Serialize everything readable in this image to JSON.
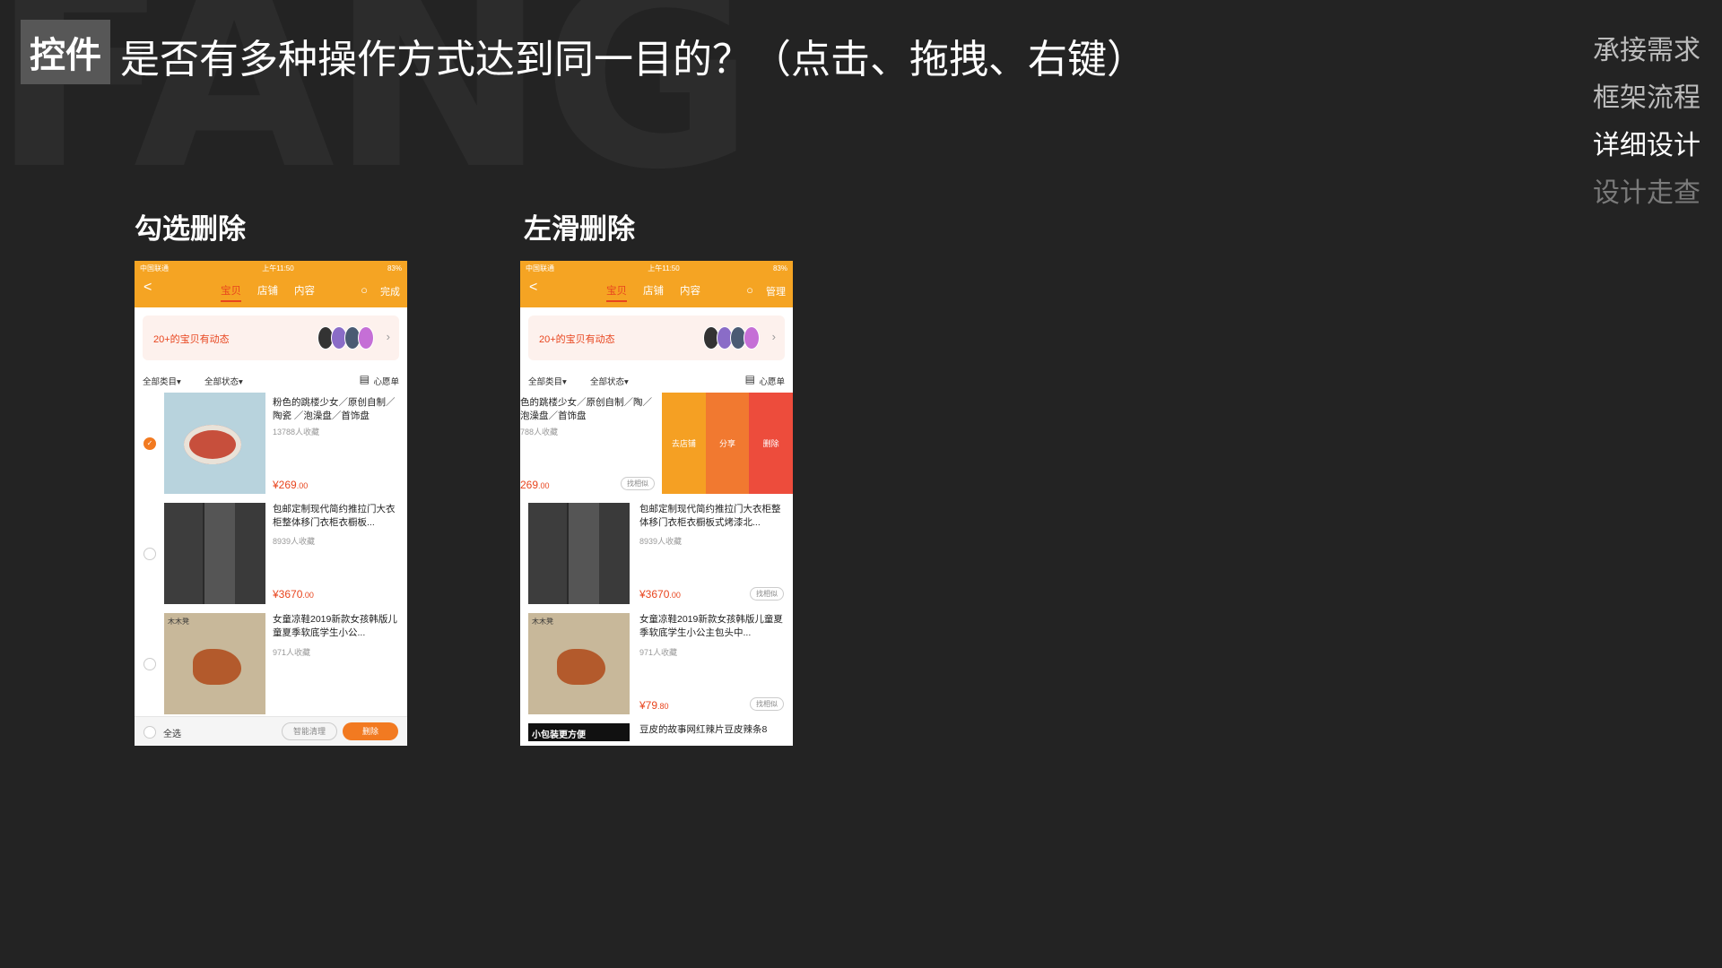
{
  "background_word": "FANG",
  "header": {
    "tag": "控件",
    "title": "是否有多种操作方式达到同一目的？（点击、拖拽、右键）"
  },
  "sidenav": {
    "items": [
      "承接需求",
      "框架流程",
      "详细设计",
      "设计走查"
    ],
    "active": "详细设计"
  },
  "sections": {
    "left_label": "勾选删除",
    "right_label": "左滑删除"
  },
  "phone": {
    "status": {
      "carrier": "中国联通",
      "time": "上午11:50",
      "battery": "83%"
    },
    "tabs": [
      "宝贝",
      "店铺",
      "内容"
    ],
    "back": "<",
    "search": "○",
    "left_action": "完成",
    "right_action": "管理",
    "banner_text": "20+的宝贝有动态",
    "banner_arrow": "›",
    "filter_category": "全部类目▾",
    "filter_status": "全部状态▾",
    "filter_grid": "▤",
    "filter_wishlist": "心愿单",
    "similar_label": "找相似",
    "check_mark": "✓",
    "products": [
      {
        "title": "粉色的跳楼少女／原创自制／陶瓷 ／泡澡盘／首饰盘",
        "fav": "13788人收藏",
        "price_int": "¥269",
        "price_dec": ".00"
      },
      {
        "title": "包邮定制现代简约推拉门大衣柜整体移门衣柜衣橱板...",
        "fav": "8939人收藏",
        "price_int": "¥3670",
        "price_dec": ".00"
      },
      {
        "title": "女童凉鞋2019新款女孩韩版儿童夏季软底学生小公...",
        "fav": "971人收藏",
        "price_int": "¥79",
        "price_dec": ".80"
      }
    ],
    "right_products": {
      "swiped_title": "色的跳楼少女／原创自制／陶／泡澡盘／首饰盘",
      "swiped_fav": "788人收藏",
      "swiped_price_int": "269",
      "swiped_price_dec": ".00",
      "wardrobe_title": "包邮定制现代简约推拉门大衣柜整体移门衣柜衣橱板式烤漆北...",
      "shoe_title": "女童凉鞋2019新款女孩韩版儿童夏季软底学生小公主包头中...",
      "fourth_img": "小包装更方便",
      "fourth_title": "豆皮的故事网红辣片豆皮辣条8"
    },
    "shoe_brand": "木木凳",
    "swipe_actions": [
      "去店铺",
      "分享",
      "删除"
    ],
    "bottom": {
      "select_all": "全选",
      "smart_clean": "智能清理",
      "delete": "删除"
    }
  }
}
